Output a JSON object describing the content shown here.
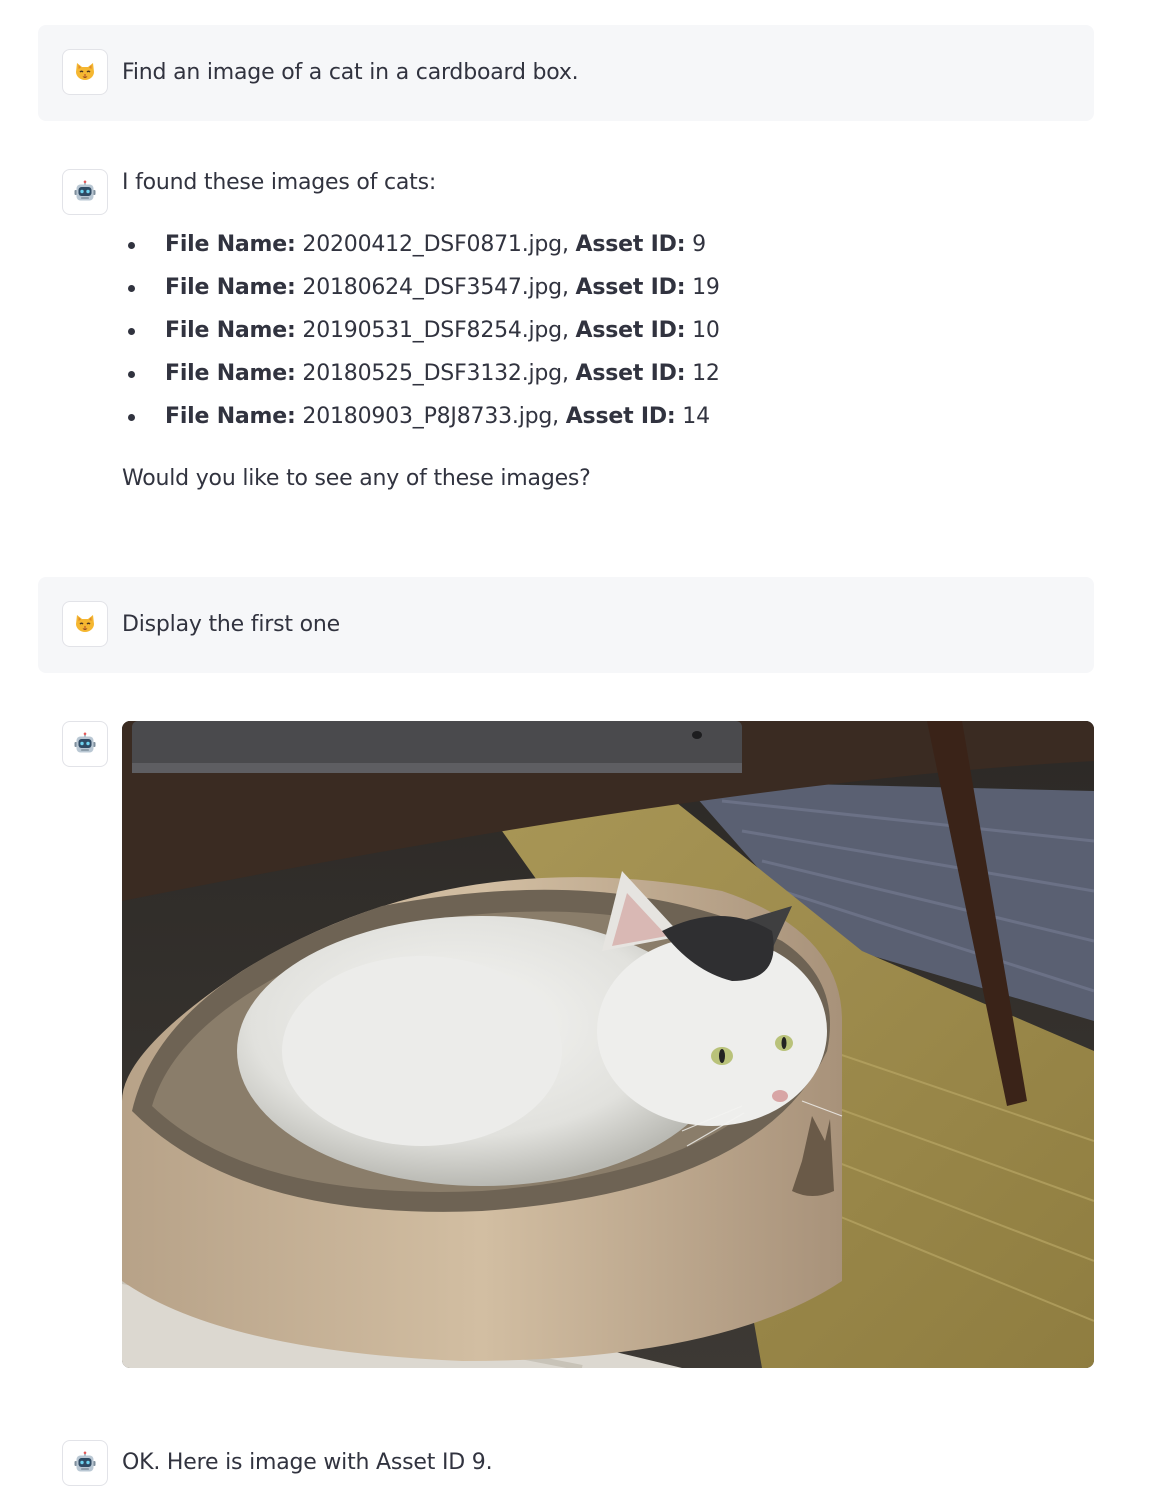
{
  "messages": {
    "user1": {
      "avatar_icon": "cat-face-icon",
      "text": "Find an image of a cat in a cardboard box."
    },
    "assistant1": {
      "avatar_icon": "robot-face-icon",
      "intro": "I found these images of cats:",
      "file_name_label": "File Name:",
      "asset_id_label": "Asset ID:",
      "files": [
        {
          "file_name": "20200412_DSF0871.jpg,",
          "asset_id": "9"
        },
        {
          "file_name": "20180624_DSF3547.jpg,",
          "asset_id": "19"
        },
        {
          "file_name": "20190531_DSF8254.jpg,",
          "asset_id": "10"
        },
        {
          "file_name": "20180525_DSF3132.jpg,",
          "asset_id": "12"
        },
        {
          "file_name": "20180903_P8J8733.jpg,",
          "asset_id": "14"
        }
      ],
      "outro": "Would you like to see any of these images?"
    },
    "user2": {
      "avatar_icon": "cat-face-icon",
      "text": "Display the first one"
    },
    "assistant2": {
      "avatar_icon": "robot-face-icon",
      "image_subject": "white-and-black cat resting in a round cardboard scratcher bed"
    },
    "assistant3": {
      "avatar_icon": "robot-face-icon",
      "text": "OK. Here is image with Asset ID 9."
    }
  },
  "colors": {
    "text": "#31333f",
    "user_message_bg": "#f6f7f9",
    "avatar_border": "#e2e3e8"
  }
}
